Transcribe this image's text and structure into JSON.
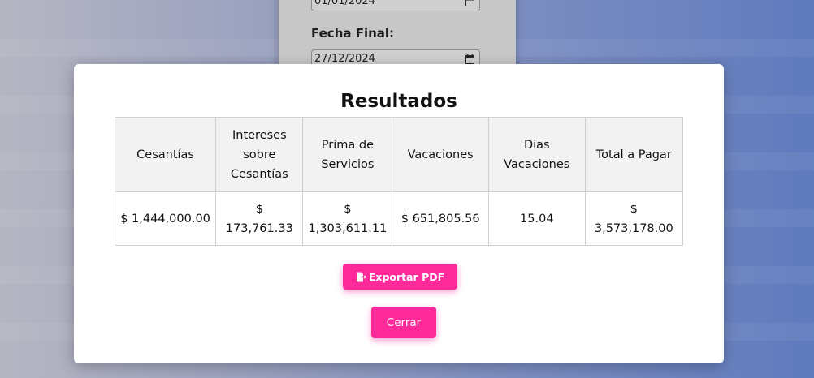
{
  "form": {
    "start_date_value": "01/01/2024",
    "end_label": "Fecha Final:",
    "end_date_value": "27/12/2024"
  },
  "modal": {
    "title": "Resultados",
    "columns": [
      "Cesantías",
      "Intereses sobre Cesantías",
      "Prima de Servicios",
      "Vacaciones",
      "Dias Vacaciones",
      "Total a Pagar"
    ],
    "row": [
      "$ 1,444,000.00",
      "$ 173,761.33",
      "$ 1,303,611.11",
      "$ 651,805.56",
      "15.04",
      "$ 3,573,178.00"
    ],
    "export_label": "Exportar PDF",
    "close_label": "Cerrar"
  },
  "icons": {
    "export": "file-export-icon",
    "calendar": "calendar-icon"
  },
  "colors": {
    "accent": "#ff2a9a",
    "modal_bg": "#ffffff",
    "header_bg": "#f2f2f2"
  }
}
